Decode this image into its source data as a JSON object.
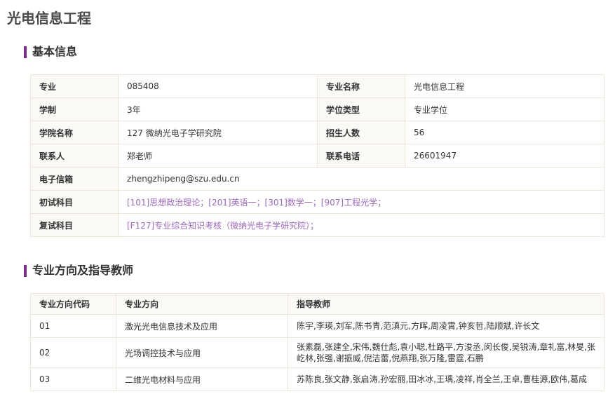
{
  "page_title": "光电信息工程",
  "basic_info": {
    "heading": "基本信息",
    "rows": [
      [
        {
          "label": "专业",
          "value": "085408"
        },
        {
          "label": "专业名称",
          "value": "光电信息工程"
        }
      ],
      [
        {
          "label": "学制",
          "value": "3年"
        },
        {
          "label": "学位类型",
          "value": "专业学位"
        }
      ],
      [
        {
          "label": "学院名称",
          "value": "127 微纳光电子学研究院"
        },
        {
          "label": "招生人数",
          "value": "56"
        }
      ],
      [
        {
          "label": "联系人",
          "value": "郑老师"
        },
        {
          "label": "联系电话",
          "value": "26601947"
        }
      ]
    ],
    "email": {
      "label": "电子信箱",
      "value": "zhengzhipeng@szu.edu.cn"
    },
    "initial_exam": {
      "label": "初试科目",
      "value": "[101]思想政治理论；[201]英语一；[301]数学一；[907]工程光学；"
    },
    "retest": {
      "label": "复试科目",
      "value": "[F127]专业综合知识考核（微纳光电子学研究院）；"
    }
  },
  "directions": {
    "heading": "专业方向及指导教师",
    "columns": [
      "专业方向代码",
      "专业方向",
      "指导教师"
    ],
    "rows": [
      {
        "code": "01",
        "name": "激光光电信息技术及应用",
        "teachers": "陈宇,李瑛,刘军,陈书青,范滇元,方晖,周凌霄,钟亥哲,陆顺斌,许长文"
      },
      {
        "code": "02",
        "name": "光场调控技术与应用",
        "teachers": "张素磊,张建全,宋伟,魏仕彪,袁小聪,杜路平,方浚丞,闵长俊,吴锐涛,章礼富,林旻,张屹林,张强,谢振威,倪洁蕾,倪燕翔,张万隆,雷霆,石鹏"
      },
      {
        "code": "03",
        "name": "二维光电材料与应用",
        "teachers": "苏陈良,张文静,张启涛,孙宏丽,田冰冰,王瑀,凌祥,肖全兰,王卓,曹桂源,欧伟,葛成"
      }
    ]
  }
}
